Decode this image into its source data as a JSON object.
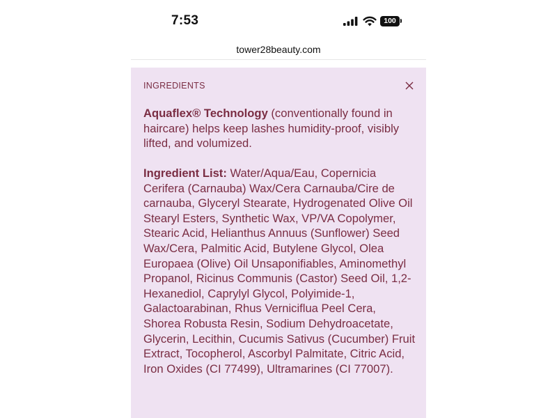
{
  "status_bar": {
    "time": "7:53",
    "battery": "100",
    "icons": [
      "signal-icon",
      "wifi-icon",
      "battery-icon"
    ]
  },
  "browser": {
    "url": "tower28beauty.com"
  },
  "panel": {
    "title": "INGREDIENTS",
    "close_icon": "close-icon",
    "technology_label": "Aquaflex® Technology",
    "technology_text": " (conventionally found in haircare) helps keep lashes humidity-proof, visibly lifted, and volumized.",
    "ingredient_list_label": "Ingredient List:",
    "ingredient_list_text": " Water/Aqua/Eau, Copernicia Cerifera (Carnauba) Wax/Cera Carnauba/Cire de carnauba, Glyceryl Stearate, Hydrogenated Olive Oil Stearyl Esters, Synthetic Wax, VP/VA Copolymer, Stearic Acid, Helianthus Annuus (Sunflower) Seed Wax/Cera, Palmitic Acid, Butylene Glycol, Olea Europaea (Olive) Oil Unsaponifiables, Aminomethyl Propanol, Ricinus Communis (Castor) Seed Oil, 1,2-Hexanediol, Caprylyl Glycol, Polyimide-1, Galactoarabinan, Rhus Verniciflua Peel Cera, Shorea Robusta Resin, Sodium Dehydroacetate, Glycerin, Lecithin, Cucumis Sativus (Cucumber) Fruit Extract, Tocopherol, Ascorbyl Palmitate, Citric Acid, Iron Oxides (CI 77499), Ultramarines (CI 77007)."
  },
  "colors": {
    "panel_bg": "#efe2f2",
    "text": "#7a2d43"
  }
}
